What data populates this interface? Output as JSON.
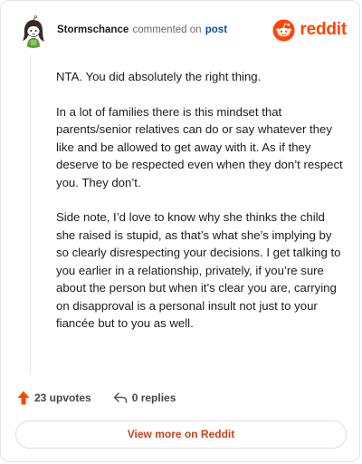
{
  "comment": {
    "author": "Stormschance",
    "action_text": "commented on",
    "target_link": "post",
    "paragraphs": [
      "NTA. You did absolutely the right thing.",
      "In a lot of families there is this mindset that parents/senior relatives can do or say whatever they like and be allowed to get away with it. As if they deserve to be respected even when they don’t respect you. They don’t.",
      "Side note, I’d love to know why she thinks the child she raised is stupid, as that’s what she’s implying by so clearly disrespecting your decisions. I get talking to you earlier in a relationship, privately, if you’re sure about the person but when it’s clear you are, carrying on disapproval is a personal insult not just to your fiancée but to you as well."
    ]
  },
  "brand": {
    "name": "reddit",
    "color": "#ff4500"
  },
  "actions": {
    "upvotes": "23 upvotes",
    "replies": "0 replies"
  },
  "footer": {
    "view_more": "View more on Reddit"
  },
  "icons": {
    "avatar": "snoo-avatar-icon",
    "brand": "reddit-logo-icon",
    "upvote": "upvote-arrow-icon",
    "reply": "reply-arrow-icon"
  }
}
